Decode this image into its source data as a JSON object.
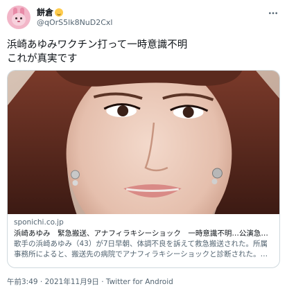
{
  "user": {
    "display_name": "餅倉",
    "handle": "@qOrS5lk8NuD2Cxl"
  },
  "tweet": {
    "text": "浜崎あゆみワクチン打って一時意識不明\nこれが真実です"
  },
  "card": {
    "domain": "sponichi.co.jp",
    "title": "浜崎あゆみ　緊急搬送、アナフィラキシーショック　一時意識不明…公演急き…",
    "description": "歌手の浜崎あゆみ（43）が7日早朝、体調不良を訴えて救急搬送された。所属事務所によると、搬送先の病院でアナフィラキシーショックと診断された。一…"
  },
  "footer": {
    "time": "午前3:49",
    "separator": " · ",
    "date": "2021年11月9日",
    "source": "Twitter for Android"
  },
  "colors": {
    "text_primary": "#0f1419",
    "text_secondary": "#536471",
    "border": "#cfd9de"
  },
  "icons": {
    "more": "more-horizontal-icon",
    "emoji": "grinning-face-emoji"
  }
}
